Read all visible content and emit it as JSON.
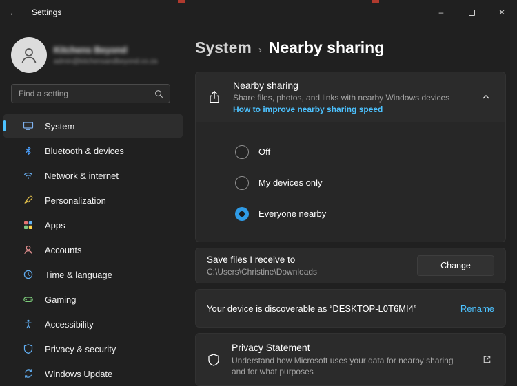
{
  "titlebar": {
    "title": "Settings"
  },
  "icons": {
    "back": "←",
    "minimize": "–",
    "close": "✕"
  },
  "sidebar": {
    "user": {
      "name": "Kitchens Beyond",
      "email": "admin@kitchensandbeyond.co.za"
    },
    "search": {
      "placeholder": "Find a setting"
    },
    "items": [
      {
        "label": "System",
        "selected": true
      },
      {
        "label": "Bluetooth & devices",
        "selected": false
      },
      {
        "label": "Network & internet",
        "selected": false
      },
      {
        "label": "Personalization",
        "selected": false
      },
      {
        "label": "Apps",
        "selected": false
      },
      {
        "label": "Accounts",
        "selected": false
      },
      {
        "label": "Time & language",
        "selected": false
      },
      {
        "label": "Gaming",
        "selected": false
      },
      {
        "label": "Accessibility",
        "selected": false
      },
      {
        "label": "Privacy & security",
        "selected": false
      },
      {
        "label": "Windows Update",
        "selected": false
      }
    ]
  },
  "main": {
    "breadcrumb": {
      "parent": "System",
      "separator": "›",
      "current": "Nearby sharing"
    },
    "nearby_card": {
      "title": "Nearby sharing",
      "description": "Share files, photos, and links with nearby Windows devices",
      "link": "How to improve nearby sharing speed",
      "options": [
        {
          "label": "Off",
          "selected": false
        },
        {
          "label": "My devices only",
          "selected": false
        },
        {
          "label": "Everyone nearby",
          "selected": true
        }
      ]
    },
    "save_card": {
      "title": "Save files I receive to",
      "path": "C:\\Users\\Christine\\Downloads",
      "button": "Change"
    },
    "discover_card": {
      "text": "Your device is discoverable as “DESKTOP-L0T6MI4”",
      "action": "Rename"
    },
    "privacy_card": {
      "title": "Privacy Statement",
      "description": "Understand how Microsoft uses your data for nearby sharing and for what purposes"
    }
  },
  "colors": {
    "accent_link": "#4cc2ff",
    "radio_selected": "#2f9be6",
    "card_background": "#2b2b2b",
    "page_background": "#202020"
  }
}
